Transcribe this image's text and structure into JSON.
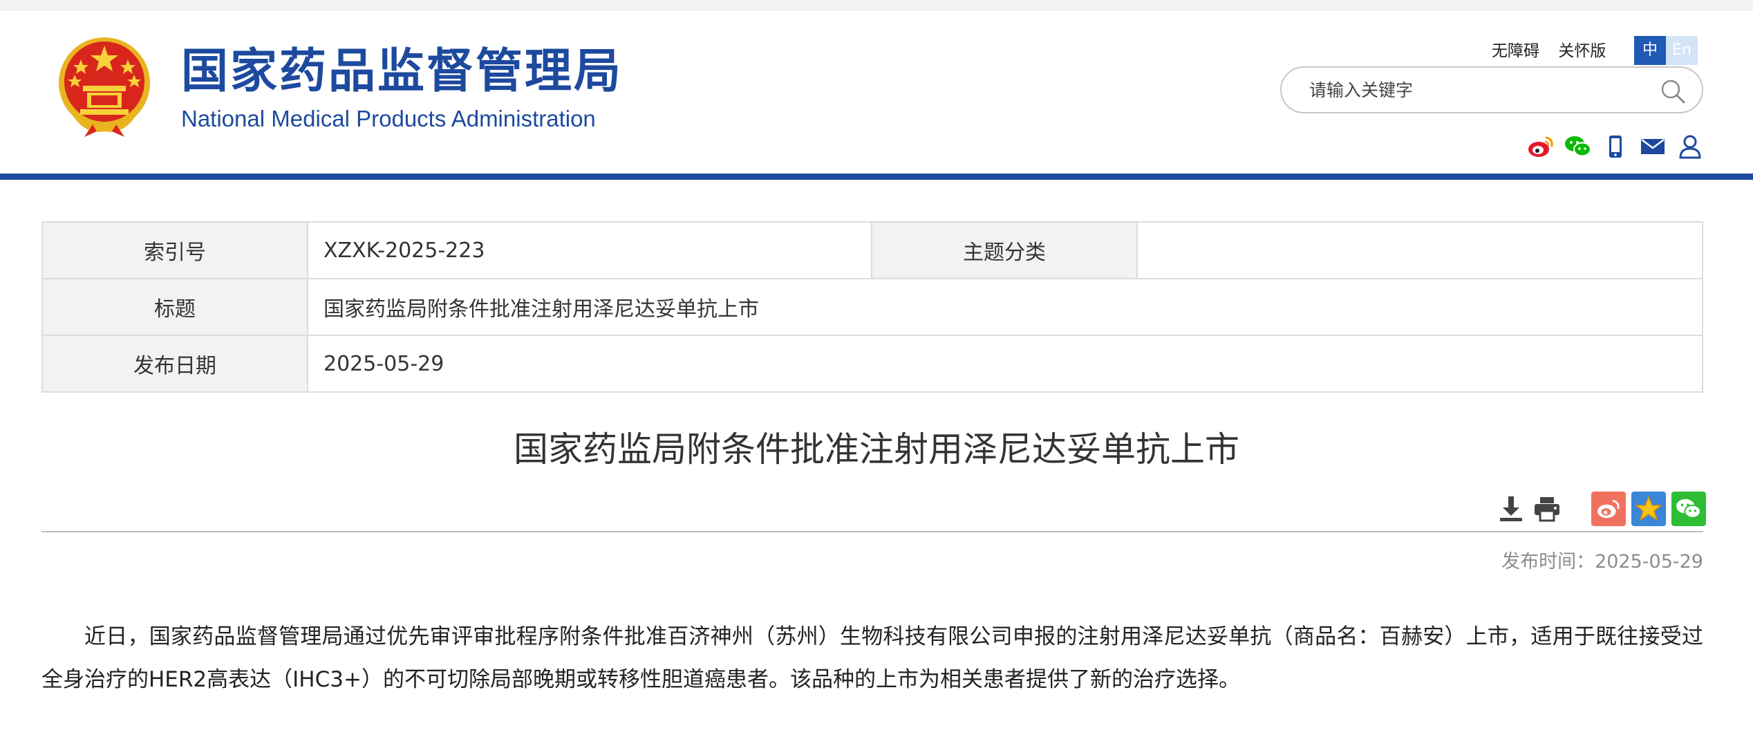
{
  "header": {
    "site_title": "国家药品监督管理局",
    "site_subtitle": "National Medical Products Administration",
    "accessibility_link": "无障碍",
    "elder_link": "关怀版",
    "lang_zh": "中",
    "lang_en": "En",
    "search_placeholder": "请输入关键字",
    "social_icons": [
      "weibo-icon",
      "wechat-icon",
      "mobile-icon",
      "mail-icon",
      "user-icon"
    ]
  },
  "info_table": {
    "index_label": "索引号",
    "index_value": "XZXK-2025-223",
    "topic_label": "主题分类",
    "topic_value": "",
    "title_label": "标题",
    "title_value": "国家药监局附条件批准注射用泽尼达妥单抗上市",
    "date_label": "发布日期",
    "date_value": "2025-05-29"
  },
  "article": {
    "title": "国家药监局附条件批准注射用泽尼达妥单抗上市",
    "publish_time": "发布时间：2025-05-29",
    "body": "近日，国家药品监督管理局通过优先审评审批程序附条件批准百济神州（苏州）生物科技有限公司申报的注射用泽尼达妥单抗（商品名：百赫安）上市，适用于既往接受过全身治疗的HER2高表达（IHC3+）的不可切除局部晚期或转移性胆道癌患者。该品种的上市为相关患者提供了新的治疗选择。"
  },
  "colors": {
    "brand_blue": "#1d4a9e",
    "weibo_red": "#e6162d",
    "wechat_green": "#09bb07",
    "share_weibo_bg": "#f1715f",
    "share_qzone_bg": "#3a86d8",
    "share_wechat_bg": "#2fbd35"
  }
}
